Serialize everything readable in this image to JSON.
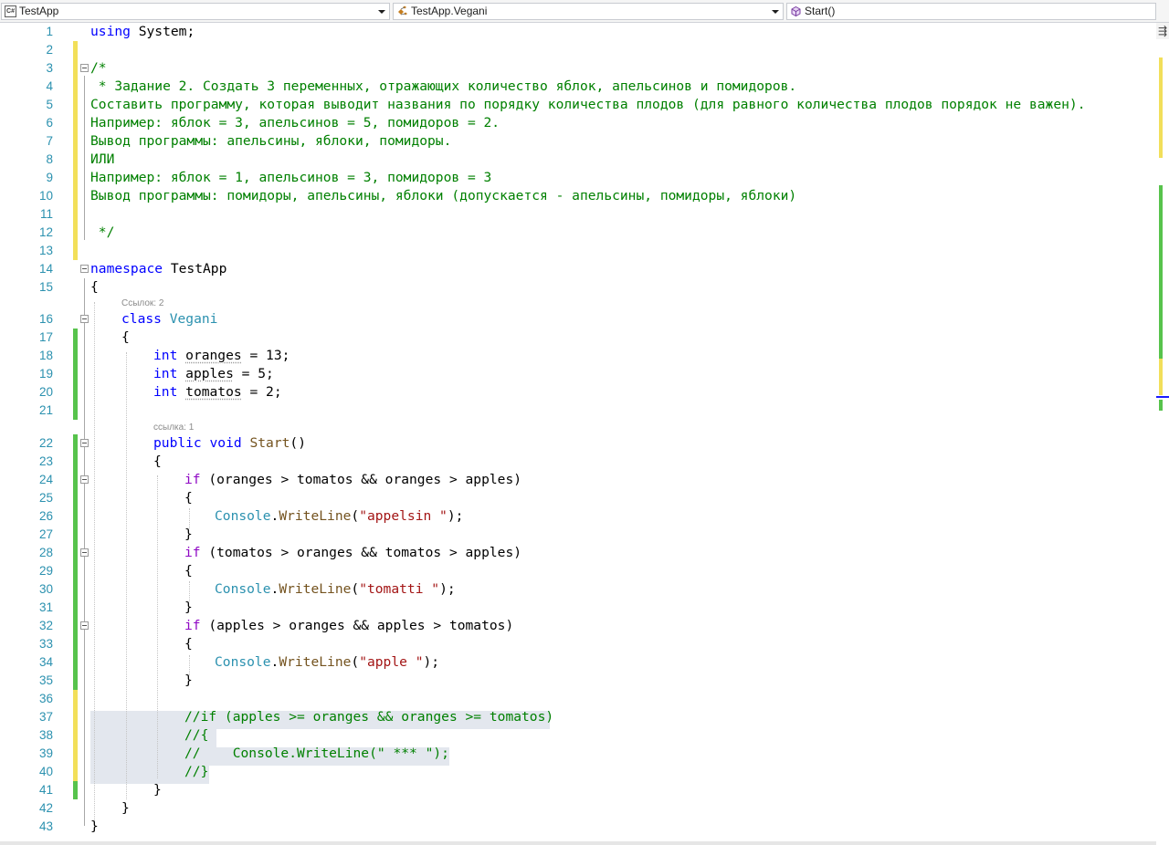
{
  "navbar": {
    "project": "TestApp",
    "class_scope": "TestApp.Vegani",
    "member": "Start()",
    "project_icon_text": "C#"
  },
  "code_lens": {
    "vegani_refs": "Ссылок: 2",
    "start_refs": "ссылка: 1"
  },
  "lines": [
    "1",
    "2",
    "3",
    "4",
    "5",
    "6",
    "7",
    "8",
    "9",
    "10",
    "11",
    "12",
    "13",
    "14",
    "15",
    "16",
    "17",
    "18",
    "19",
    "20",
    "21",
    "22",
    "23",
    "24",
    "25",
    "26",
    "27",
    "28",
    "29",
    "30",
    "31",
    "32",
    "33",
    "34",
    "35",
    "36",
    "37",
    "38",
    "39",
    "40",
    "41",
    "42",
    "43"
  ],
  "code": {
    "l1_kw": "using",
    "l1_rest": " System;",
    "l3": "/*",
    "l4": " * Задание 2. Создать 3 переменных, отражающих количество яблок, апельсинов и помидоров.",
    "l5": "Составить программу, которая выводит названия по порядку количества плодов (для равного количества плодов порядок не важен).",
    "l6": "Например: яблок = 3, апельсинов = 5, помидоров = 2.",
    "l7": "Вывод программы: апельсины, яблоки, помидоры.",
    "l8": "ИЛИ",
    "l9": "Например: яблок = 1, апельсинов = 3, помидоров = 3",
    "l10": "Вывод программы: помидоры, апельсины, яблоки (допускается - апельсины, помидоры, яблоки)",
    "l12": " */",
    "l14_kw": "namespace",
    "l14_rest": " TestApp",
    "l15": "{",
    "l16_kw": "class",
    "l16_name": "Vegani",
    "l17": "{",
    "l18_kw": "int",
    "l18_var": "oranges",
    "l18_rest": " = 13;",
    "l19_kw": "int",
    "l19_var": "apples",
    "l19_rest": " = 5;",
    "l20_kw": "int",
    "l20_var": "tomatos",
    "l20_rest": " = 2;",
    "l22_kw1": "public",
    "l22_kw2": "void",
    "l22_name": "Start",
    "l22_rest": "()",
    "l23": "{",
    "l24_if": "if",
    "l24_rest": " (oranges > tomatos && oranges > apples)",
    "l25": "{",
    "l26_cls": "Console",
    "l26_mth": "WriteLine",
    "l26_str": "\"appelsin \"",
    "l27": "}",
    "l28_if": "if",
    "l28_rest": " (tomatos > oranges && tomatos > apples)",
    "l29": "{",
    "l30_cls": "Console",
    "l30_mth": "WriteLine",
    "l30_str": "\"tomatti \"",
    "l31": "}",
    "l32_if": "if",
    "l32_rest": " (apples > oranges && apples > tomatos)",
    "l33": "{",
    "l34_cls": "Console",
    "l34_mth": "WriteLine",
    "l34_str": "\"apple \"",
    "l35": "}",
    "l37": "//if (apples >= oranges && oranges >= tomatos)",
    "l38": "//{",
    "l39": "//    Console.WriteLine(\" *** \");",
    "l40": "//}",
    "l41": "}",
    "l42": "}",
    "l43": "}"
  },
  "colors": {
    "keyword": "#0000ff",
    "control": "#8f08c4",
    "type": "#2b91af",
    "method": "#74531f",
    "string": "#a31515",
    "comment": "#008000",
    "saved_change": "#57c34c",
    "unsaved_change": "#f2df5a"
  }
}
